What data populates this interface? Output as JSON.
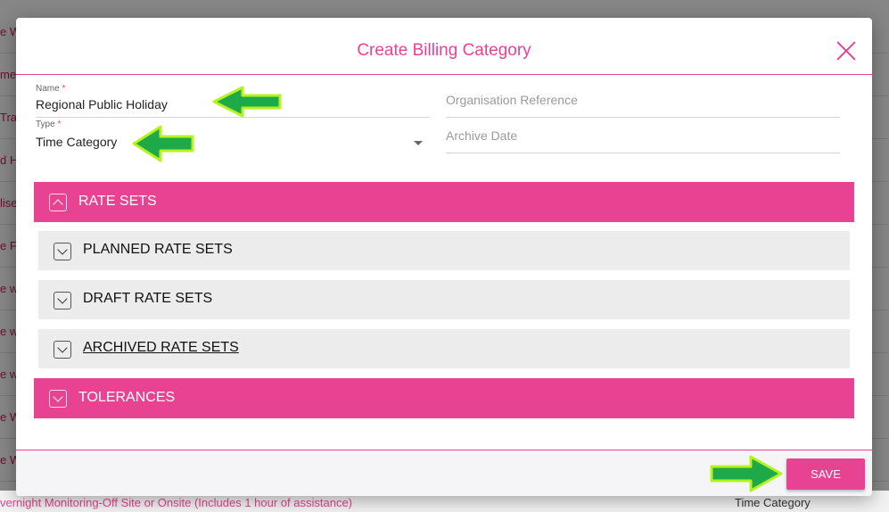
{
  "background": {
    "rows": [
      "e W",
      "me",
      "Tra",
      "d H",
      "lise",
      "e F",
      "e w",
      "e w",
      "e w",
      "e W",
      "e W"
    ],
    "last_row_left": "vernight Monitoring-Off Site or Onsite (Includes 1 hour of assistance)",
    "last_row_right": "Time Category"
  },
  "modal": {
    "title": "Create Billing Category",
    "fields": {
      "name_label": "Name",
      "name_value": "Regional Public Holiday",
      "type_label": "Type",
      "type_value": "Time Category",
      "required_mark": "*",
      "org_ref_placeholder": "Organisation Reference",
      "archive_date_placeholder": "Archive Date"
    },
    "sections": {
      "rate_sets": "RATE SETS",
      "planned_rate_sets": "PLANNED RATE SETS",
      "draft_rate_sets": "DRAFT RATE SETS",
      "archived_rate_sets": "ARCHIVED RATE SETS",
      "tolerances": "TOLERANCES"
    },
    "save_label": "SAVE"
  },
  "colors": {
    "accent": "#e84393",
    "sub_bar": "#ececec",
    "arrow_fill": "#1faa4a",
    "arrow_outline": "#b6f21e"
  }
}
